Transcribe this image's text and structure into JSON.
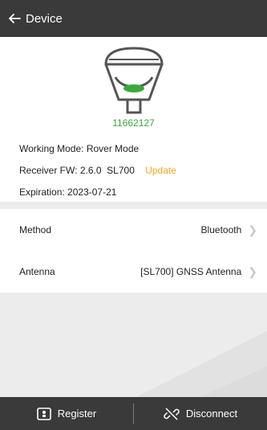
{
  "header": {
    "title": "Device"
  },
  "device": {
    "serial": "11662127"
  },
  "info": {
    "working_mode_label": "Working Mode:",
    "working_mode_value": "Rover Mode",
    "receiver_fw_label": "Receiver FW:",
    "receiver_fw_value": "2.6.0  SL700",
    "update_label": "Update",
    "expiration_label": "Expiration:",
    "expiration_value": "2023-07-21"
  },
  "rows": {
    "method": {
      "label": "Method",
      "value": "Bluetooth"
    },
    "antenna": {
      "label": "Antenna",
      "value": "[SL700] GNSS Antenna"
    }
  },
  "bottom": {
    "register_label": "Register",
    "disconnect_label": "Disconnect"
  },
  "colors": {
    "header_bg": "#3a3a3a",
    "serial": "#3aa83a",
    "update": "#f5a623"
  }
}
